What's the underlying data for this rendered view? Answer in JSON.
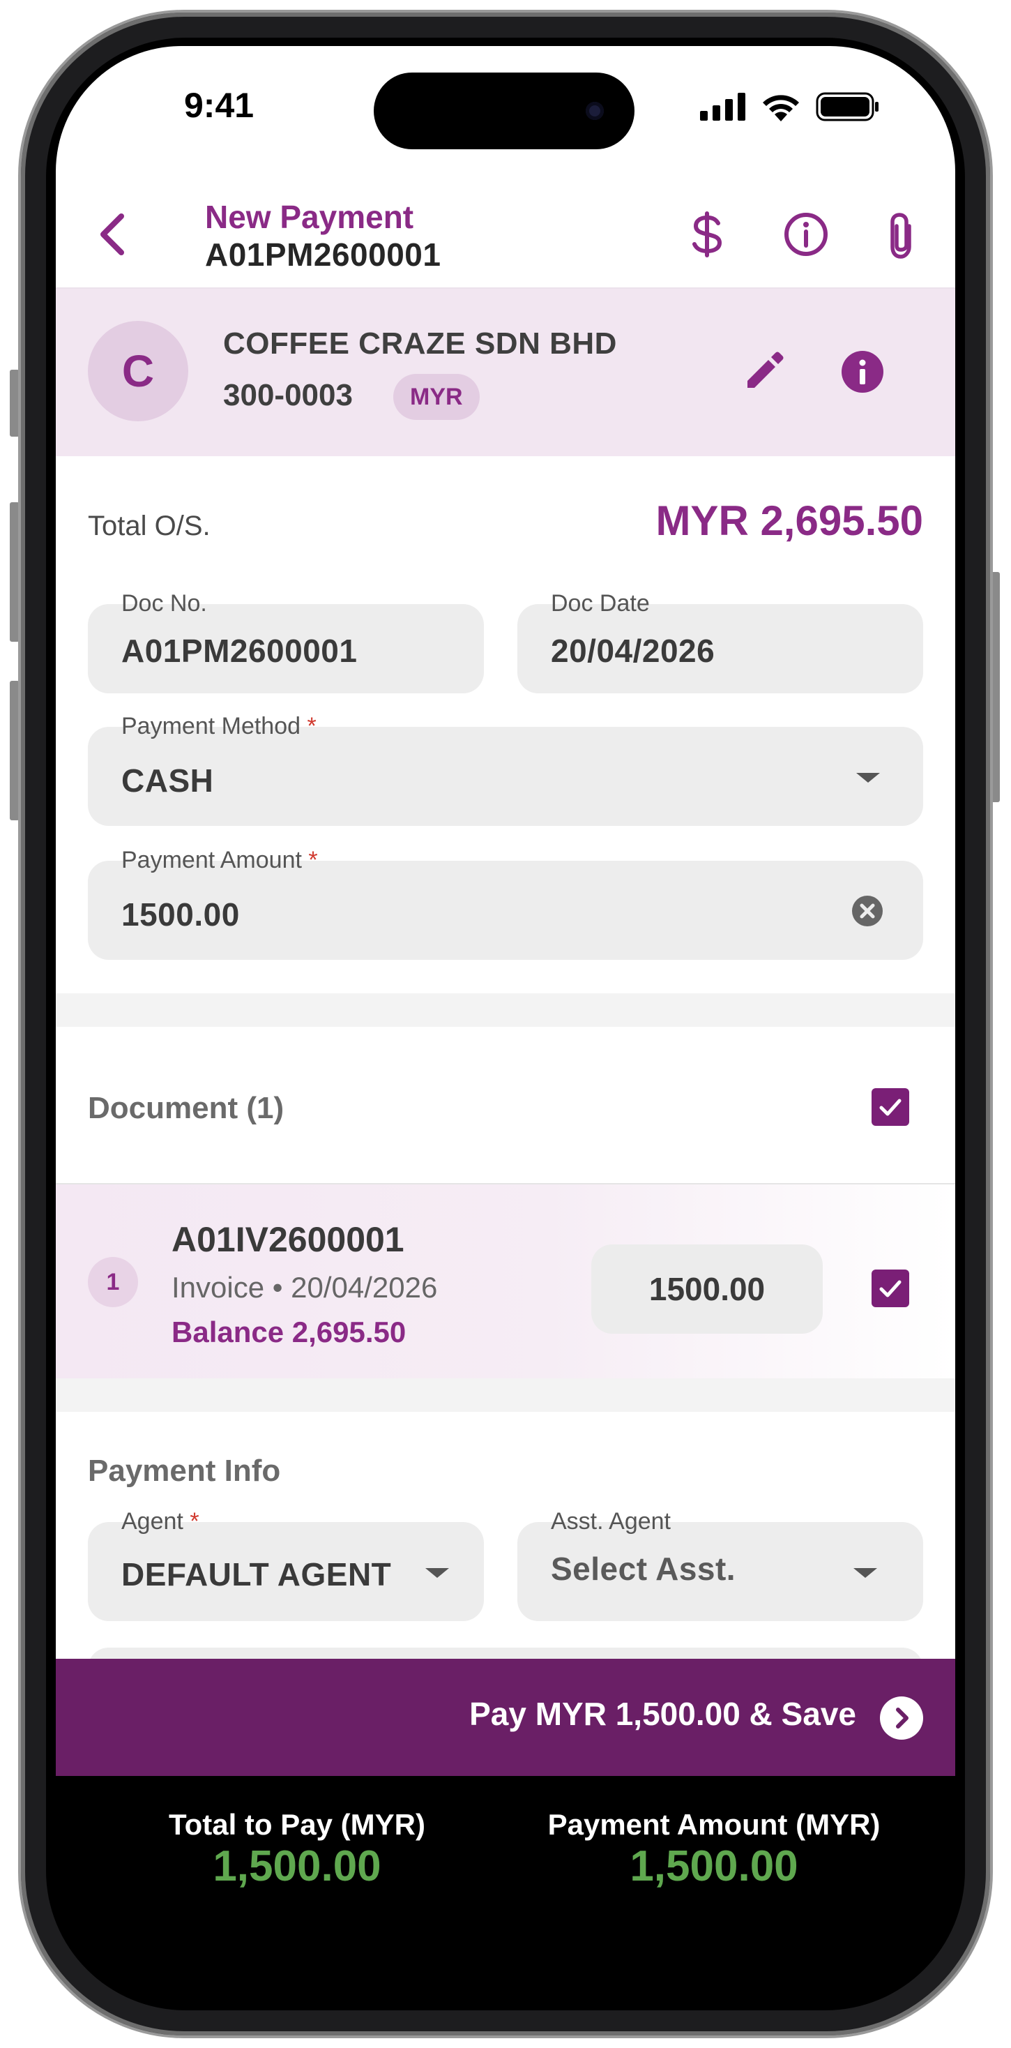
{
  "status_bar": {
    "time": "9:41"
  },
  "nav": {
    "title": "New Payment",
    "doc_no": "A01PM2600001",
    "icons": [
      "back-chevron-icon",
      "dollar-icon",
      "info-outline-icon",
      "paperclip-icon"
    ]
  },
  "customer": {
    "initial": "C",
    "name": "COFFEE CRAZE SDN BHD",
    "code": "300-0003",
    "currency": "MYR"
  },
  "total": {
    "label": "Total O/S.",
    "value": "MYR 2,695.50"
  },
  "form": {
    "doc_no": {
      "label": "Doc No.",
      "value": "A01PM2600001"
    },
    "doc_date": {
      "label": "Doc Date",
      "value": "20/04/2026"
    },
    "payment_method": {
      "label": "Payment Method",
      "required": "*",
      "value": "CASH"
    },
    "payment_amount": {
      "label": "Payment Amount",
      "required": "*",
      "value": "1500.00"
    }
  },
  "documents": {
    "header": "Document (1)",
    "rows": [
      {
        "index": "1",
        "doc_no": "A01IV2600001",
        "meta": "Invoice • 20/04/2026",
        "balance": "Balance 2,695.50",
        "amount": "1500.00"
      }
    ]
  },
  "payment_info": {
    "header": "Payment Info",
    "agent": {
      "label": "Agent",
      "required": "*",
      "value": "DEFAULT AGENT"
    },
    "asst_agent": {
      "label": "Asst. Agent",
      "value": "Select Asst."
    }
  },
  "save": {
    "label": "Pay MYR 1,500.00 & Save"
  },
  "summary": {
    "total_label": "Total to Pay (MYR)",
    "total_value": "1,500.00",
    "amount_label": "Payment Amount (MYR)",
    "amount_value": "1,500.00"
  },
  "colors": {
    "brand_purple": "#8a2a86",
    "save_bar": "#6a1f66",
    "summary_green": "#5fa84f"
  }
}
